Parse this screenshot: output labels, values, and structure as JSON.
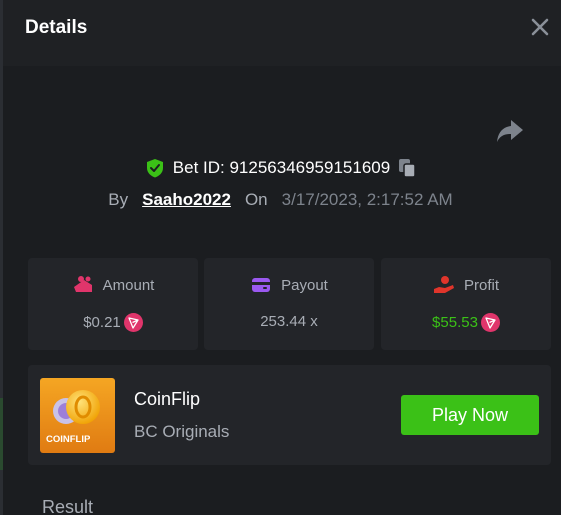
{
  "header": {
    "title": "Details",
    "close_icon": "close-icon"
  },
  "bet": {
    "share_icon": "share-icon",
    "shield_icon": "verified-shield-icon",
    "id_text": "Bet ID: 91256346959151609",
    "copy_icon": "copy-icon",
    "by_label": "By",
    "username": "Saaho2022",
    "on_label": "On",
    "datetime": "3/17/2023, 2:17:52 AM"
  },
  "stats": {
    "amount": {
      "label": "Amount",
      "value": "$0.21",
      "icon": "amount-icon",
      "currency_icon": "tron-icon"
    },
    "payout": {
      "label": "Payout",
      "value": "253.44 x",
      "icon": "wallet-card-icon"
    },
    "profit": {
      "label": "Profit",
      "value": "$55.53",
      "icon": "profit-hand-icon",
      "currency_icon": "tron-icon"
    }
  },
  "game": {
    "thumb_label": "COINFLIP",
    "name": "CoinFlip",
    "provider": "BC Originals",
    "play_label": "Play Now"
  },
  "result_label": "Result",
  "colors": {
    "accent_green": "#3bc117",
    "panel": "#232529",
    "background": "#1b1d20",
    "muted_text": "#a8adb5",
    "tron_pink": "#e0356b"
  }
}
